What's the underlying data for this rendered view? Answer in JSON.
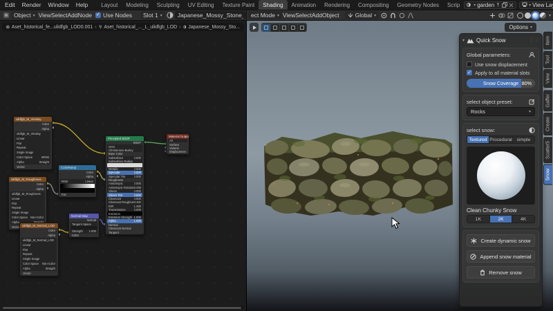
{
  "colors": {
    "accent": "#4772b3",
    "tex_header": "#7a4a21",
    "bsdf_header": "#237a4a",
    "output_header": "#6e2a20",
    "ramp_header": "#2e6d99",
    "nmap_header": "#5656ad",
    "wire_yellow": "#c7b12c",
    "wire_green": "#5ca55c",
    "wire_purple": "#6b6bc0",
    "wire_gray": "#9a9a9a"
  },
  "topbar": {
    "menus": [
      "Edit",
      "Render",
      "Window",
      "Help"
    ],
    "workspaces": [
      "Layout",
      "Modeling",
      "Sculpting",
      "UV Editing",
      "Texture Paint",
      {
        "t": "Shading",
        "active": true
      },
      "Animation",
      "Rendering",
      "Compositing",
      "Geometry Nodes",
      "Scrip"
    ],
    "scene_name": "garden",
    "view_layer_name": "View Layer"
  },
  "shader_editor": {
    "header": {
      "object_type": "Object",
      "menus": [
        "View",
        "Select",
        "Add",
        "Node"
      ],
      "use_nodes_label": "Use Nodes",
      "use_nodes_checked": true,
      "slot": "Slot 1",
      "material_name": "Japanese_Mossy_Stone_u"
    },
    "breadcrumb": [
      "Aset_historical_fe...ulidfgb_LOD0.001",
      "Aset_historical_..._L_ulidfgb_LOD",
      "Japanese_Mossy_Sto..."
    ],
    "nodes": {
      "tex_basecolor": {
        "title": "ulidfgb_M_Viewlay",
        "rows": [
          {
            "t": "Color",
            "c": "out"
          },
          {
            "t": "Alpha",
            "c": "out"
          },
          {
            "t": "ulidfgb_M_Viewlay",
            "c": "img"
          },
          {
            "t": "Linear",
            "c": "dd"
          },
          {
            "t": "Flat",
            "c": "dd"
          },
          {
            "t": "Repeat",
            "c": "dd"
          },
          {
            "t": "Single Image",
            "c": "dd"
          },
          {
            "t": "Color Space",
            "v": "sRGB",
            "c": "num"
          },
          {
            "t": "Alpha",
            "v": "Straight",
            "c": "num"
          },
          {
            "t": "Vector",
            "c": "in"
          }
        ]
      },
      "principled": {
        "title": "Principled BSDF",
        "rows": [
          {
            "t": "BSDF",
            "c": "out"
          },
          {
            "t": "GGX",
            "c": "dd"
          },
          {
            "t": "Christensen-Burley",
            "c": "dd"
          },
          {
            "t": "Base Color",
            "c": "in"
          },
          {
            "t": "Subsurface",
            "v": "0.000",
            "c": "num"
          },
          {
            "t": "Subsurface Radius",
            "c": "dd"
          },
          {
            "t": "",
            "c": "swatchw"
          },
          {
            "t": "Metallic",
            "v": "0.000",
            "c": "num"
          },
          {
            "t": "Specular",
            "v": "0.500",
            "c": "blue"
          },
          {
            "t": "Specular Tint",
            "v": "0.000",
            "c": "num"
          },
          {
            "t": "Roughness",
            "c": "in"
          },
          {
            "t": "Anisotropic",
            "v": "0.000",
            "c": "num"
          },
          {
            "t": "Anisotropic Rotation",
            "v": "0.000",
            "c": "num"
          },
          {
            "t": "Sheen",
            "v": "0.000",
            "c": "num"
          },
          {
            "t": "Sheen Tint",
            "v": "0.500",
            "c": "blue"
          },
          {
            "t": "Clearcoat",
            "v": "0.000",
            "c": "num"
          },
          {
            "t": "Clearcoat Roughness",
            "v": "0.030",
            "c": "num"
          },
          {
            "t": "IOR",
            "v": "1.450",
            "c": "num"
          },
          {
            "t": "Transmission",
            "v": "0.000",
            "c": "num"
          },
          {
            "t": "Emission",
            "c": "swatchb"
          },
          {
            "t": "Emission Strength",
            "v": "1.000",
            "c": "num"
          },
          {
            "t": "Alpha",
            "v": "1.000",
            "c": "blue"
          },
          {
            "t": "Normal",
            "c": "in"
          },
          {
            "t": "Clearcoat Normal",
            "c": "in"
          },
          {
            "t": "Tangent",
            "c": "in"
          }
        ]
      },
      "material_output": {
        "title": "Material Output",
        "rows": [
          {
            "t": "All",
            "c": "dd"
          },
          {
            "t": "Surface",
            "c": "in"
          },
          {
            "t": "Volume",
            "c": "in"
          },
          {
            "t": "Displacement",
            "c": "in"
          }
        ]
      },
      "colorramp": {
        "title": "ColorRamp",
        "rows": [
          {
            "t": "Color",
            "c": "out"
          },
          {
            "t": "Alpha",
            "c": "out"
          },
          {
            "t": "RGB",
            "v": "Linear",
            "c": "dd"
          },
          {
            "t": "",
            "c": "gradient"
          },
          {
            "t": "",
            "c": "swatchb"
          },
          {
            "t": "Fac",
            "c": "in"
          }
        ]
      },
      "tex_roughness": {
        "title": "ulidfgb_M_Roughness",
        "rows": [
          {
            "t": "Color",
            "c": "out"
          },
          {
            "t": "Alpha",
            "c": "out"
          },
          {
            "t": "ulidfgb_M_Roughness",
            "c": "img"
          },
          {
            "t": "Linear",
            "c": "dd"
          },
          {
            "t": "Flat",
            "c": "dd"
          },
          {
            "t": "Repeat",
            "c": "dd"
          },
          {
            "t": "Single Image",
            "c": "dd"
          },
          {
            "t": "Color Space",
            "v": "Non-Color",
            "c": "num"
          },
          {
            "t": "Alpha",
            "v": "Straight",
            "c": "num"
          },
          {
            "t": "Vector",
            "c": "in"
          }
        ]
      },
      "normal_map": {
        "title": "Normal Map",
        "rows": [
          {
            "t": "Normal",
            "c": "out"
          },
          {
            "t": "Tangent Space",
            "c": "dd"
          },
          {
            "t": "",
            "c": "field"
          },
          {
            "t": "Strength",
            "v": "1.000",
            "c": "num"
          },
          {
            "t": "Color",
            "c": "in"
          }
        ]
      },
      "tex_normal": {
        "title": "ulidfgb_M_Normal_LOD",
        "rows": [
          {
            "t": "Color",
            "c": "out"
          },
          {
            "t": "Alpha",
            "c": "out"
          },
          {
            "t": "ulidfgb_M_Normal_LOD",
            "c": "img"
          },
          {
            "t": "Linear",
            "c": "dd"
          },
          {
            "t": "Flat",
            "c": "dd"
          },
          {
            "t": "Repeat",
            "c": "dd"
          },
          {
            "t": "Single Image",
            "c": "dd"
          },
          {
            "t": "Color Space",
            "v": "Non-Color",
            "c": "num"
          },
          {
            "t": "Alpha",
            "v": "Straight",
            "c": "num"
          },
          {
            "t": "Vector",
            "c": "in"
          }
        ]
      }
    }
  },
  "viewport": {
    "mode": "ect Mode",
    "menus": [
      "View",
      "Select",
      "Add",
      "Object"
    ],
    "orientation": "Global",
    "options_label": "Options"
  },
  "sidebar": {
    "panel_title": "Quick Snow",
    "global_box": {
      "title": "Global parameters:",
      "checkbox_displacement": {
        "label": "Use snow displacement",
        "checked": false
      },
      "checkbox_slots": {
        "label": "Apply to all material slots",
        "checked": true
      },
      "slider": {
        "label": "Snow Coverage",
        "value": "80%",
        "fraction": 0.8
      }
    },
    "preset_box": {
      "title": "select object preset:",
      "dropdown_value": "Rocks"
    },
    "snow_box": {
      "title": "select snow:",
      "type_tabs": [
        {
          "t": "Textured",
          "active": true
        },
        {
          "t": "Procedural"
        },
        {
          "t": "simple"
        }
      ],
      "preview_label": "Clean Chunky Snow",
      "resolutions": [
        {
          "t": "1K"
        },
        {
          "t": "2K",
          "active": true
        },
        {
          "t": "4K"
        }
      ]
    },
    "actions": {
      "create": "Create dynamic snow",
      "append": "Append snow material",
      "remove": "Remove snow"
    },
    "tabs": [
      {
        "t": "Item"
      },
      {
        "t": "Tool"
      },
      {
        "t": "View"
      },
      {
        "t": "Gaffer"
      },
      {
        "t": "Create"
      },
      {
        "t": "Scatter5"
      },
      {
        "t": "Snow",
        "active": true
      }
    ]
  }
}
